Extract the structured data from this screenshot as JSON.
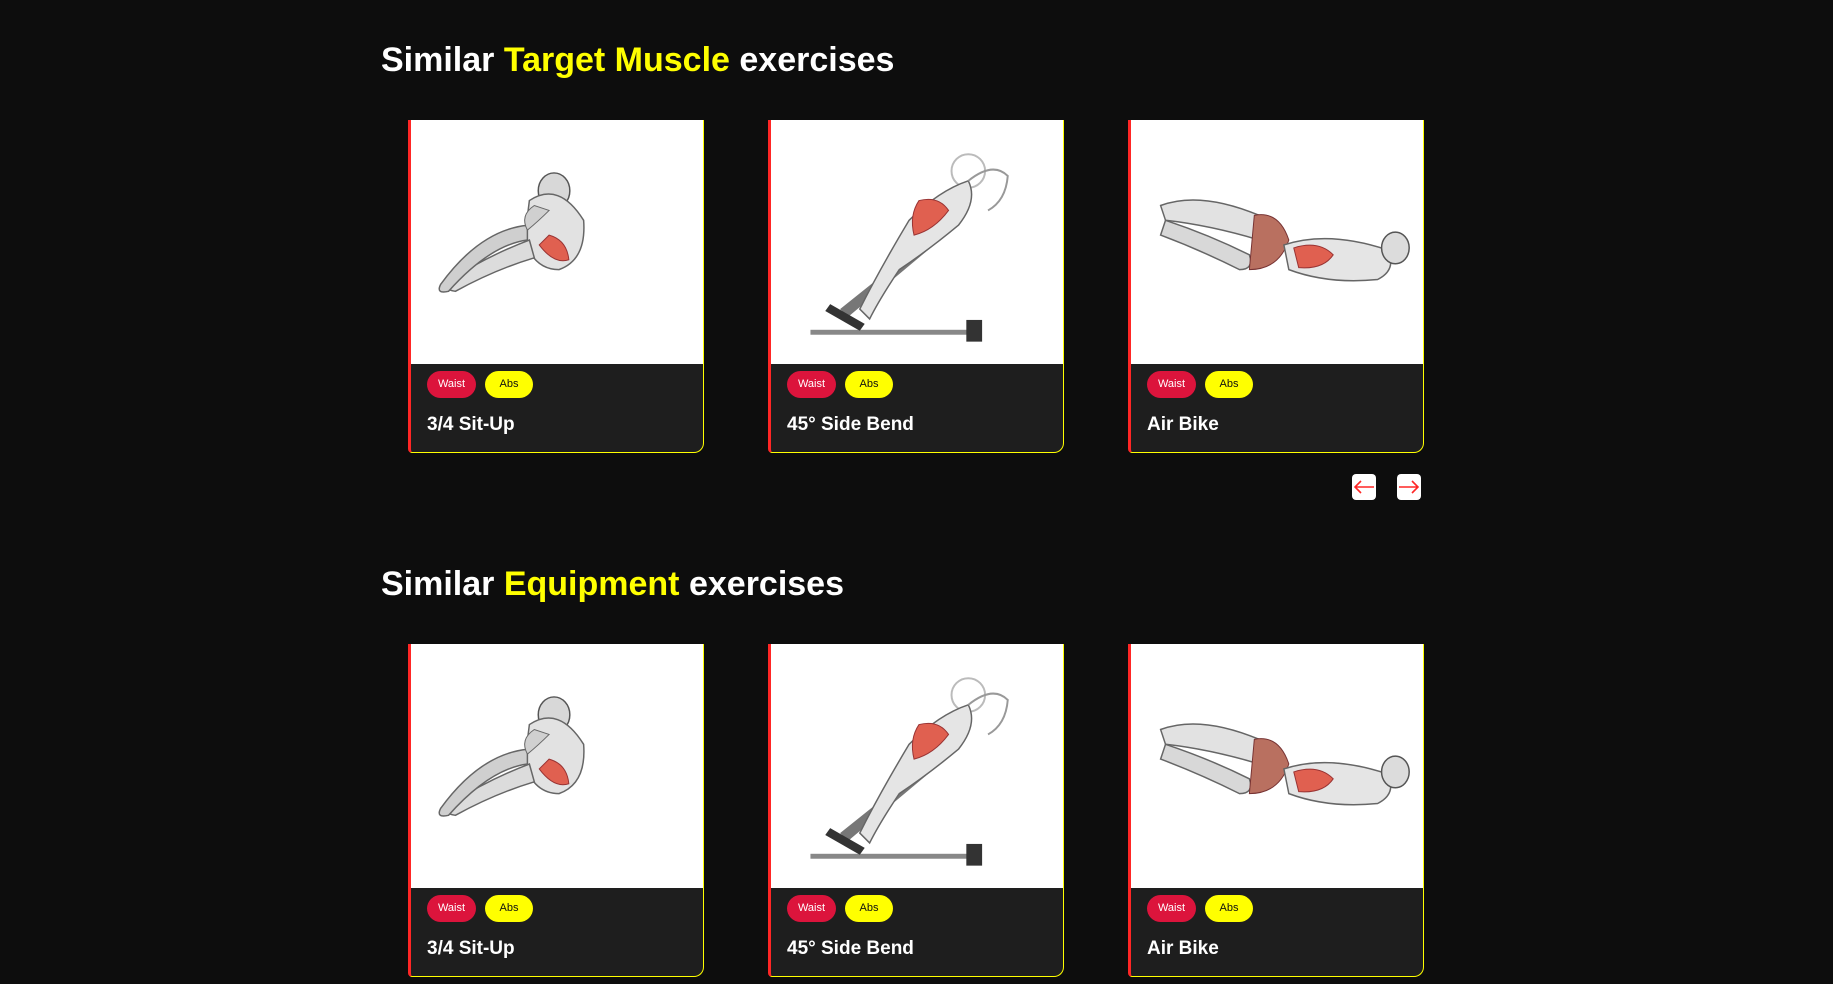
{
  "section_target": {
    "heading_prefix": "Similar ",
    "heading_highlight": "Target Muscle",
    "heading_suffix": " exercises",
    "cards": [
      {
        "name": "3/4 Sit-Up",
        "tags": [
          "Waist",
          "Abs"
        ],
        "figure": "situp-figure"
      },
      {
        "name": "45° Side Bend",
        "tags": [
          "Waist",
          "Abs"
        ],
        "figure": "side-bend-figure"
      },
      {
        "name": "Air Bike",
        "tags": [
          "Waist",
          "Abs"
        ],
        "figure": "air-bike-figure"
      }
    ]
  },
  "section_equipment": {
    "heading_prefix": "Similar ",
    "heading_highlight": "Equipment",
    "heading_suffix": " exercises",
    "cards": [
      {
        "name": "3/4 Sit-Up",
        "tags": [
          "Waist",
          "Abs"
        ],
        "figure": "situp-figure"
      },
      {
        "name": "45° Side Bend",
        "tags": [
          "Waist",
          "Abs"
        ],
        "figure": "side-bend-figure"
      },
      {
        "name": "Air Bike",
        "tags": [
          "Waist",
          "Abs"
        ],
        "figure": "air-bike-figure"
      }
    ]
  },
  "pagination": {
    "prev_icon": "arrow-left-icon",
    "next_icon": "arrow-right-icon"
  },
  "colors": {
    "background": "#0d0d0d",
    "card": "#1e1e1e",
    "highlight": "#ffff00",
    "accent": "#ff2625",
    "waist_tag": "#dc143c"
  }
}
